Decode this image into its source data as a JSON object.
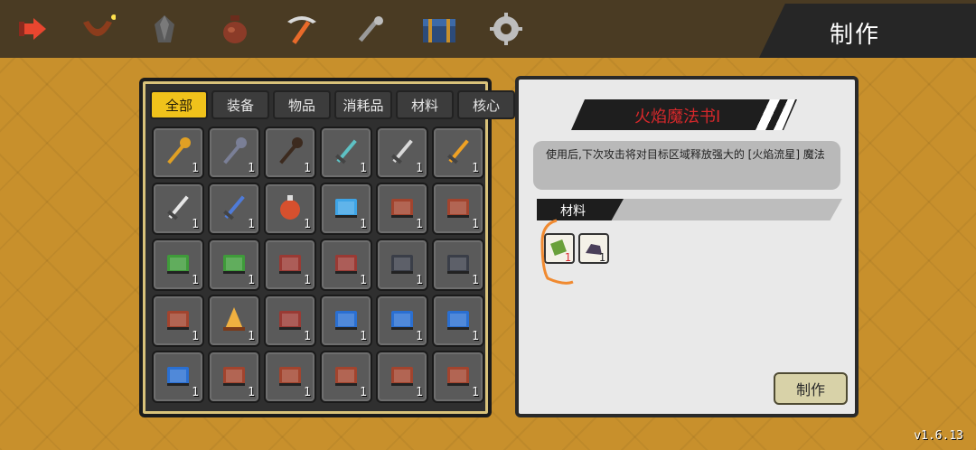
{
  "window": {
    "title": "制作",
    "version": "v1.6.13"
  },
  "topbar_icons": [
    {
      "name": "back-arrow-icon",
      "color": "#e8462f"
    },
    {
      "name": "bag-icon",
      "color": "#8c3c1c"
    },
    {
      "name": "gem-icon",
      "color": "#5a5a5a"
    },
    {
      "name": "pot-icon",
      "color": "#8b3b28"
    },
    {
      "name": "pickaxe-icon",
      "color": "#d9d9d9"
    },
    {
      "name": "fishing-rod-icon",
      "color": "#9a9a9a"
    },
    {
      "name": "chest-icon",
      "color": "#2c4b7a"
    },
    {
      "name": "settings-gear-icon",
      "color": "#bdbdbd"
    }
  ],
  "inventory": {
    "tabs": [
      {
        "label": "全部",
        "active": true
      },
      {
        "label": "装备",
        "active": false
      },
      {
        "label": "物品",
        "active": false
      },
      {
        "label": "消耗品",
        "active": false
      },
      {
        "label": "材料",
        "active": false
      },
      {
        "label": "核心",
        "active": false
      }
    ],
    "items": [
      {
        "icon": "golden-staff-icon",
        "count": "1",
        "color": "#e0a024"
      },
      {
        "icon": "iron-hammer-staff-icon",
        "count": "1",
        "color": "#7a7f96"
      },
      {
        "icon": "wooden-staff-icon",
        "count": "1",
        "color": "#3c2a1e"
      },
      {
        "icon": "dagger-icon",
        "count": "1",
        "color": "#5ec1c4"
      },
      {
        "icon": "sword-icon",
        "count": "1",
        "color": "#d9d9d9"
      },
      {
        "icon": "flame-sword-icon",
        "count": "1",
        "color": "#f0a224"
      },
      {
        "icon": "longsword-icon",
        "count": "1",
        "color": "#e6e6e6"
      },
      {
        "icon": "blue-hilt-sword-icon",
        "count": "1",
        "color": "#4f7bd8"
      },
      {
        "icon": "potion-icon",
        "count": "1",
        "color": "#d6502e"
      },
      {
        "icon": "blue-spellbook-icon",
        "count": "1",
        "color": "#3ea4e6"
      },
      {
        "icon": "red-scroll-book-icon",
        "count": "1",
        "color": "#a2442e"
      },
      {
        "icon": "red-scroll-book-icon",
        "count": "1",
        "color": "#a2442e"
      },
      {
        "icon": "green-book-icon",
        "count": "1",
        "color": "#3f9b3a"
      },
      {
        "icon": "green-book-icon",
        "count": "1",
        "color": "#3f9b3a"
      },
      {
        "icon": "red-book-icon",
        "count": "1",
        "color": "#9a3a34"
      },
      {
        "icon": "red-book-icon",
        "count": "1",
        "color": "#9a3a34"
      },
      {
        "icon": "dark-book-icon",
        "count": "1",
        "color": "#3a3e48"
      },
      {
        "icon": "dark-book-icon",
        "count": "1",
        "color": "#3a3e48"
      },
      {
        "icon": "red-scroll-book-icon",
        "count": "1",
        "color": "#a2442e"
      },
      {
        "icon": "campfire-icon",
        "count": "1",
        "color": "#f0b040"
      },
      {
        "icon": "red-book-icon",
        "count": "1",
        "color": "#9a3a34"
      },
      {
        "icon": "blue-skill-book-icon",
        "count": "1",
        "color": "#2a6fd1"
      },
      {
        "icon": "blue-skill-book-icon",
        "count": "1",
        "color": "#2a6fd1"
      },
      {
        "icon": "blue-skill-book-icon",
        "count": "1",
        "color": "#2a6fd1"
      },
      {
        "icon": "blue-skill-book-icon",
        "count": "1",
        "color": "#2a6fd1"
      },
      {
        "icon": "red-scroll-book-icon",
        "count": "1",
        "color": "#a2442e"
      },
      {
        "icon": "red-scroll-book-icon",
        "count": "1",
        "color": "#a2442e"
      },
      {
        "icon": "red-scroll-book-icon",
        "count": "1",
        "color": "#a2442e"
      },
      {
        "icon": "red-scroll-book-icon",
        "count": "1",
        "color": "#a2442e"
      },
      {
        "icon": "red-scroll-book-icon",
        "count": "1",
        "color": "#a2442e"
      }
    ]
  },
  "detail": {
    "item_name": "火焰魔法书I",
    "description": "使用后,下次攻击将对目标区域释放强大的 [火焰流星] 魔法",
    "materials_label": "材料",
    "materials": [
      {
        "icon": "green-scroll-icon",
        "count": "1",
        "count_color": "#d7282b"
      },
      {
        "icon": "dark-ore-icon",
        "count": "1",
        "count_color": "#222222"
      }
    ],
    "craft_button": "制作"
  }
}
